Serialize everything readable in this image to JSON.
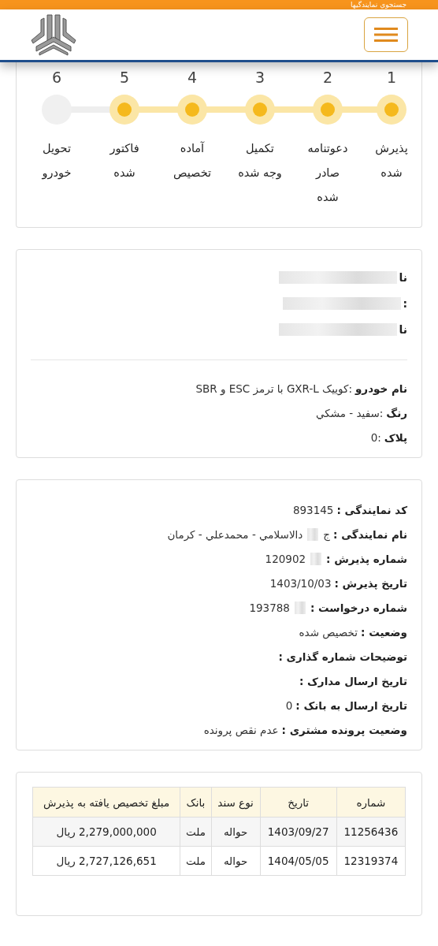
{
  "top_bar": {
    "text": "جستجوي نمايندگيها"
  },
  "steps": [
    {
      "number": "1",
      "label": "پذيرش شده",
      "done": true
    },
    {
      "number": "2",
      "label": "دعوتنامه صادر شده",
      "done": true
    },
    {
      "number": "3",
      "label": "تکميل وجه شده",
      "done": true
    },
    {
      "number": "4",
      "label": "آماده تخصيص",
      "done": true
    },
    {
      "number": "5",
      "label": "فاکتور شده",
      "done": true
    },
    {
      "number": "6",
      "label": "تحويل خودرو",
      "done": false
    }
  ],
  "customer_lines": [
    {
      "text": "نا",
      "redacted": true
    },
    {
      "text": ":",
      "redacted": true
    },
    {
      "text": "نا",
      "redacted": true
    }
  ],
  "car_lines": [
    {
      "label": "نام خودرو",
      "value": ":کوییک GXR-L با ترمز ESC و SBR"
    },
    {
      "label": "رنگ",
      "value": ":سفيد - مشکي"
    },
    {
      "label": "پلاک",
      "value": ":0"
    }
  ],
  "dealer_lines": [
    {
      "label": "کد نمایندگی :",
      "value": "893145",
      "redacted": false
    },
    {
      "label": "نام نمایندگی :",
      "value": "ج",
      "redacted": true,
      "tail": "دالاسلامي - محمدعلي - کرمان"
    },
    {
      "label": "شماره پذیرش :",
      "redacted": true,
      "tail": "120902"
    },
    {
      "label": "تاریخ پذیرش :",
      "value": "1403/10/03",
      "redacted": false
    },
    {
      "label": "شماره درخواست :",
      "redacted": true,
      "tail": "193788"
    },
    {
      "label": "وضعیت :",
      "value": "تخصیص شده",
      "redacted": false
    },
    {
      "label": "توضیحات شماره گذاری :",
      "redacted": false
    },
    {
      "label": "تاریخ ارسال مدارک :",
      "redacted": false
    },
    {
      "label": "تاریخ ارسال به بانک :",
      "value": "0",
      "redacted": false
    },
    {
      "label": "وضعیت پرونده مشتری :",
      "value": "عدم نقص پرونده",
      "redacted": false
    }
  ],
  "table": {
    "columns": [
      "شماره",
      "تاریخ",
      "نوع سند",
      "بانک",
      "مبلغ تخصیص یافته به پذیرش"
    ],
    "rows": [
      [
        "11256436",
        "1403/09/27",
        "حواله",
        "ملت",
        "2,279,000,000 ریال"
      ],
      [
        "12319374",
        "1404/05/05",
        "حواله",
        "ملت",
        "2,727,126,651 ریال"
      ]
    ]
  }
}
